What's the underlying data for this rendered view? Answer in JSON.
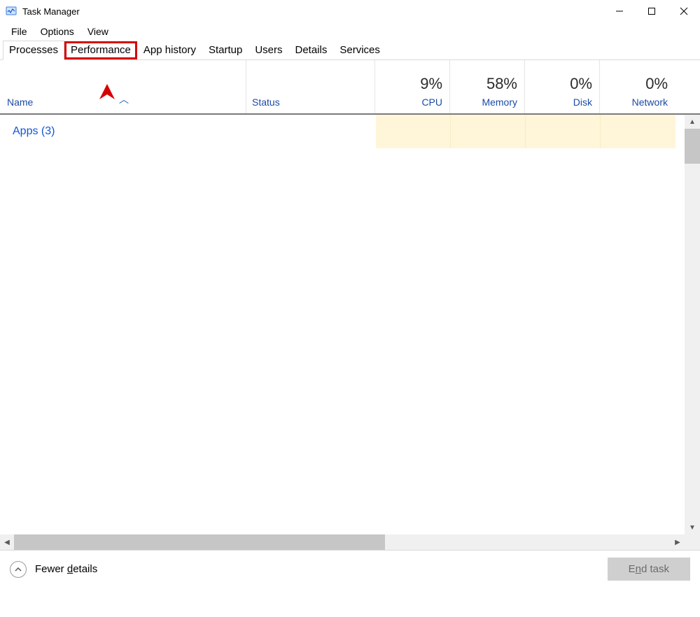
{
  "window": {
    "title": "Task Manager"
  },
  "menu": {
    "file": "File",
    "options": "Options",
    "view": "View"
  },
  "tabs": {
    "processes": "Processes",
    "performance": "Performance",
    "app_history": "App history",
    "startup": "Startup",
    "users": "Users",
    "details": "Details",
    "services": "Services"
  },
  "columns": {
    "name": "Name",
    "status": "Status",
    "cpu": {
      "pct": "9%",
      "label": "CPU"
    },
    "memory": {
      "pct": "58%",
      "label": "Memory"
    },
    "disk": {
      "pct": "0%",
      "label": "Disk"
    },
    "network": {
      "pct": "0%",
      "label": "Network"
    }
  },
  "groups": {
    "apps": "Apps (3)"
  },
  "footer": {
    "fewer_prefix": "Fewer ",
    "d": "d",
    "fewer_suffix": "etails",
    "end_prefix": "E",
    "end_n": "n",
    "end_suffix": "d task"
  }
}
